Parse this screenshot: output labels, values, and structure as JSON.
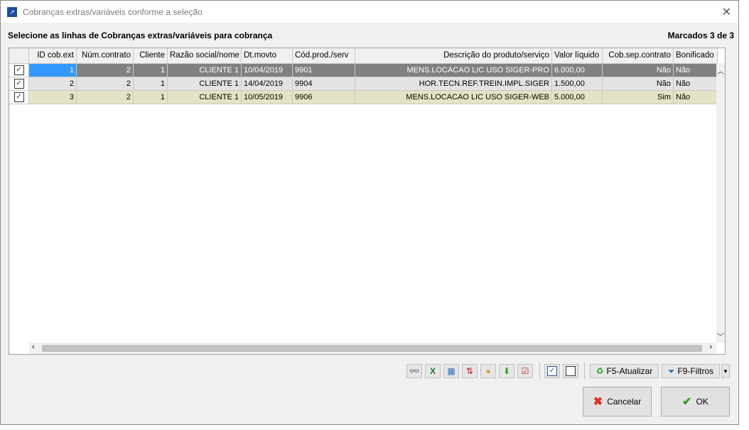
{
  "window": {
    "title": "Cobranças extras/variáveis conforme a seleção"
  },
  "heading": "Selecione as linhas de Cobranças extras/variáveis para cobrança",
  "count": "Marcados 3 de 3",
  "columns": [
    "ID cob.ext",
    "Núm.contrato",
    "Cliente",
    "Razão social/nome",
    "Dt.movto",
    "Cód.prod./serv",
    "Descrição do produto/serviço",
    "Valor líquido",
    "Cob.sep.contrato",
    "Bonificado"
  ],
  "rows": [
    [
      "1",
      "2",
      "1",
      "CLIENTE 1",
      "10/04/2019",
      "9901",
      "MENS.LOCACAO LIC USO SIGER-PRO",
      "6.000,00",
      "Não",
      "Não"
    ],
    [
      "2",
      "2",
      "1",
      "CLIENTE 1",
      "14/04/2019",
      "9904",
      "HOR.TECN.REF.TREIN.IMPL.SIGER",
      "1.500,00",
      "Não",
      "Não"
    ],
    [
      "3",
      "2",
      "1",
      "CLIENTE 1",
      "10/05/2019",
      "9906",
      "MENS.LOCACAO LIC USO SIGER-WEB",
      "5.000,00",
      "Sim",
      "Não"
    ]
  ],
  "row_checked": [
    true,
    true,
    true
  ],
  "colors": {
    "selected_row": "#808080",
    "selected_cell": "#3399ff",
    "row2": "#e3e3e3",
    "row3": "#e4e4c4"
  },
  "toolbar": {
    "refresh": "F5-Atualizar",
    "filters": "F9-Filtros"
  },
  "buttons": {
    "cancel": "Cancelar",
    "ok": "OK"
  }
}
